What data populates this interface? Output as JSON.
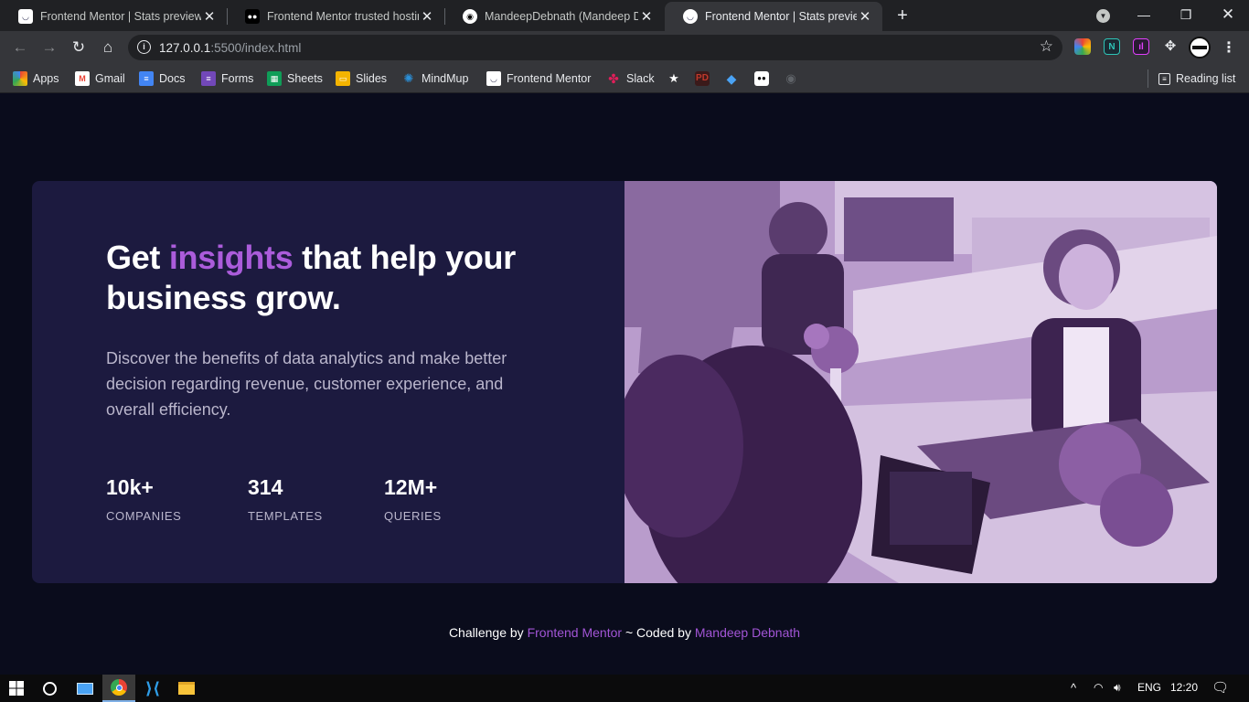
{
  "browser": {
    "tabs": [
      {
        "title": "Frontend Mentor | Stats preview c",
        "active": false
      },
      {
        "title": "Frontend Mentor trusted hosting",
        "active": false
      },
      {
        "title": "MandeepDebnath (Mandeep Deb",
        "active": false
      },
      {
        "title": "Frontend Mentor | Stats preview c",
        "active": true
      }
    ],
    "url_host": "127.0.0.1",
    "url_path": ":5500/index.html",
    "bookmarks": [
      {
        "label": "Apps",
        "icon": "apps-grid-icon",
        "color": "#ea4335"
      },
      {
        "label": "Gmail",
        "icon": "gmail-icon",
        "color": "#ea4335"
      },
      {
        "label": "Docs",
        "icon": "docs-icon",
        "color": "#4285f4"
      },
      {
        "label": "Forms",
        "icon": "forms-icon",
        "color": "#7248b9"
      },
      {
        "label": "Sheets",
        "icon": "sheets-icon",
        "color": "#0f9d58"
      },
      {
        "label": "Slides",
        "icon": "slides-icon",
        "color": "#f4b400"
      },
      {
        "label": "MindMup",
        "icon": "mindmup-icon",
        "color": "#2b90d9"
      },
      {
        "label": "Frontend Mentor",
        "icon": "frontend-mentor-icon",
        "color": "#ffffff"
      },
      {
        "label": "Slack",
        "icon": "slack-icon",
        "color": "#e01e5a"
      }
    ],
    "reading_list": "Reading list"
  },
  "page": {
    "headline_part1": "Get ",
    "headline_accent": "insights",
    "headline_part2": " that help your business grow.",
    "description": "Discover the benefits of data analytics and make better decision regarding revenue, customer experience, and overall efficiency.",
    "stats": [
      {
        "value": "10k+",
        "label": "COMPANIES"
      },
      {
        "value": "314",
        "label": "TEMPLATES"
      },
      {
        "value": "12M+",
        "label": "QUERIES"
      }
    ],
    "attribution": {
      "prefix": "Challenge by ",
      "link1": "Frontend Mentor",
      "middle": " ~ Coded by ",
      "link2": "Mandeep Debnath"
    },
    "colors": {
      "background": "#0a0c1c",
      "card": "#1c1a3f",
      "accent": "#ab5cdb",
      "photo_tint": "#b596c9"
    }
  },
  "taskbar": {
    "language": "ENG",
    "time": "12:20"
  }
}
